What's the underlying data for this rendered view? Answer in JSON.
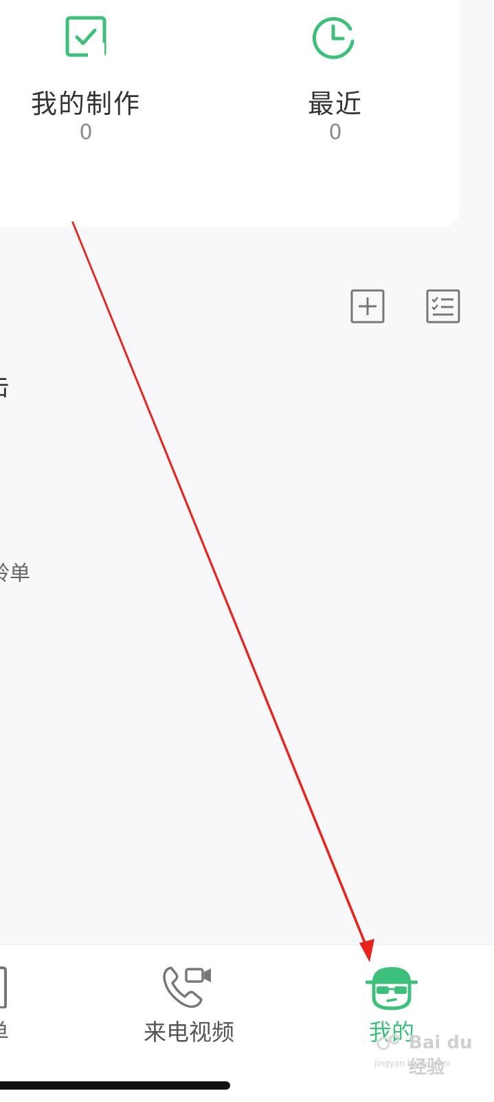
{
  "stats": {
    "my_creations": {
      "label": "我的制作",
      "count": "0",
      "icon": "checkbox-icon"
    },
    "recent": {
      "label": "最近",
      "count": "0",
      "icon": "clock-icon"
    }
  },
  "toolbar": {
    "add_icon": "add-square-icon",
    "list_icon": "checklist-icon"
  },
  "content": {
    "partial_title": "击",
    "partial_subtitle": "铃单"
  },
  "tabbar": {
    "tabs": [
      {
        "label": "单",
        "icon": "partial-icon"
      },
      {
        "label": "来电视频",
        "icon": "phone-video-icon"
      },
      {
        "label": "我的",
        "icon": "avatar-icon",
        "active": true
      }
    ],
    "active_color": "#3cc07a"
  },
  "watermark": {
    "text": "Bai du 经验",
    "url": "jingyan.baidu.com"
  },
  "annotation": {
    "arrow_color": "#e8231c"
  }
}
